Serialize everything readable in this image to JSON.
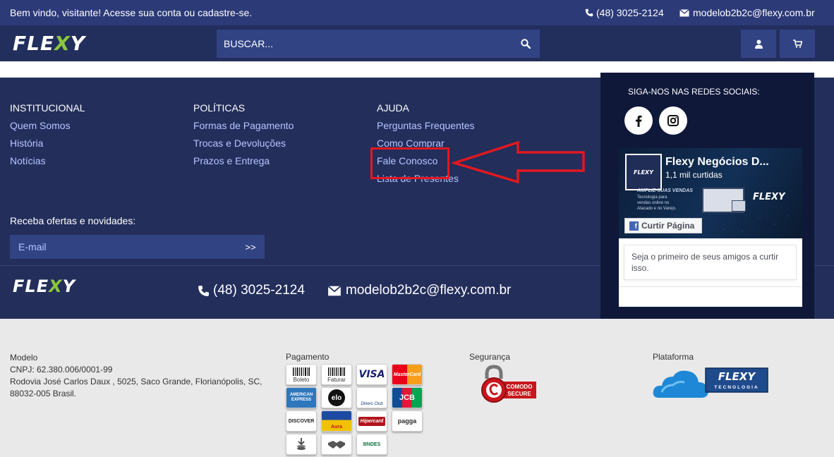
{
  "topbar": {
    "welcome": "Bem vindo, visitante! Acesse sua conta ou cadastre-se.",
    "phone": "(48) 3025-2124",
    "email": "modelob2b2c@flexy.com.br"
  },
  "header": {
    "logo_pre": "FLE",
    "logo_x": "X",
    "logo_post": "Y",
    "search_placeholder": "BUSCAR..."
  },
  "footer": {
    "columns": [
      {
        "title": "INSTITUCIONAL",
        "links": [
          "Quem Somos",
          "História",
          "Notícias"
        ]
      },
      {
        "title": "POLÍTICAS",
        "links": [
          "Formas de Pagamento",
          "Trocas e Devoluções",
          "Prazos e Entrega"
        ]
      },
      {
        "title": "AJUDA",
        "links": [
          "Perguntas Frequentes",
          "Como Comprar",
          "Fale Conosco",
          "Lista de Presentes"
        ]
      }
    ],
    "newsletter_label": "Receba ofertas e novidades:",
    "newsletter_placeholder": "E-mail",
    "newsletter_button": ">>",
    "phone": "(48) 3025-2124",
    "email": "modelob2b2c@flexy.com.br"
  },
  "social": {
    "title": "SIGA-NOS NAS REDES SOCIAIS:",
    "facebook_page": {
      "name": "Flexy Negócios D...",
      "likes": "1,1 mil curtidas",
      "thumb_text": "FLEXY",
      "cover_headline": "AMPLIE SUAS VENDAS",
      "cover_text": "Tecnologia para vendas online no Atacado e no Varejo.",
      "cover_logo": "FLEXY",
      "like_button": "Curtir Página",
      "friends_text": "Seja o primeiro de seus amigos a curtir isso."
    }
  },
  "bottom": {
    "company": {
      "name": "Modelo",
      "cnpj": "CNPJ: 62.380.006/0001-99",
      "address1": "Rodovia José Carlos Daux , 5025, Saco Grande, Florianópolis, SC,",
      "address2": "88032-005 Brasil."
    },
    "payment_title": "Pagamento",
    "payment_methods": [
      "Boleto",
      "Faturar",
      "VISA",
      "MasterCard",
      "AMERICAN EXPRESS",
      "elo",
      "Diners Club",
      "JCB",
      "DISCOVER",
      "Aura",
      "Hipercard",
      "pagga",
      "",
      "",
      "BNDES"
    ],
    "security_title": "Segurança",
    "security_seal": [
      "COMODO",
      "SECURE"
    ],
    "platform_title": "Plataforma",
    "platform_logo": "FLEXY",
    "platform_sub": "TECNOLOGIA"
  },
  "colors": {
    "topbar": "#2c3a78",
    "header": "#222e5c",
    "footer": "#232e5b",
    "input": "#324384",
    "link": "#b7c5ff",
    "annotation": "#e2181f",
    "logo_accent": "#8bc53f"
  }
}
